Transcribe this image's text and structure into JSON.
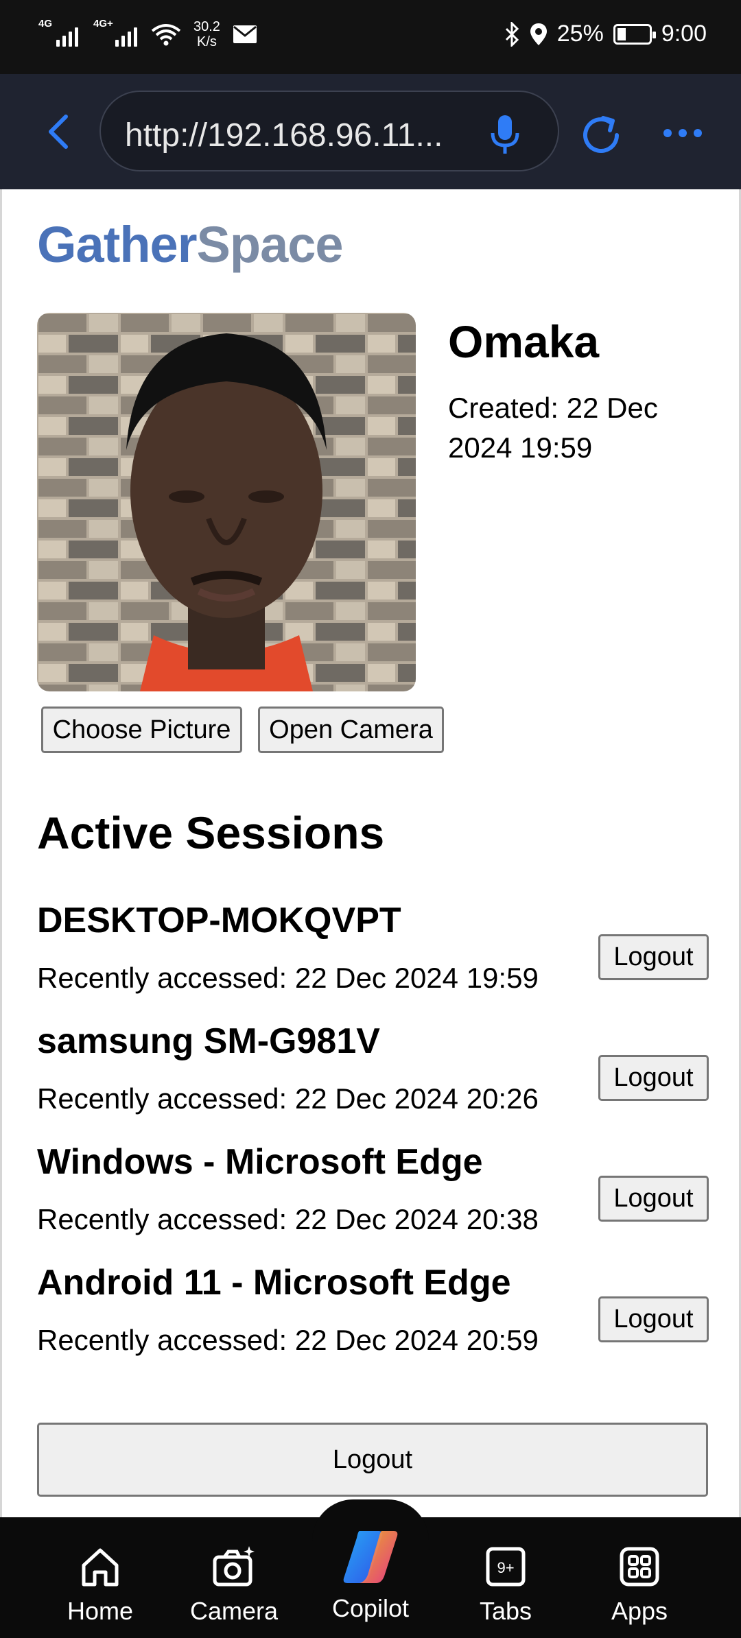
{
  "status_bar": {
    "net1": "4G",
    "net2": "4G+",
    "speed_value": "30.2",
    "speed_unit": "K/s",
    "battery": "25%",
    "time": "9:00"
  },
  "browser": {
    "url": "http://192.168.96.11..."
  },
  "page": {
    "brand_part1": "Gather",
    "brand_part2": "Space",
    "profile": {
      "name": "Omaka",
      "created": "Created: 22 Dec 2024 19:59"
    },
    "buttons": {
      "choose_picture": "Choose Picture",
      "open_camera": "Open Camera"
    },
    "sessions_title": "Active Sessions",
    "sessions": [
      {
        "device": "DESKTOP-MOKQVPT",
        "accessed": "Recently accessed: 22 Dec 2024 19:59",
        "logout": "Logout"
      },
      {
        "device": "samsung SM-G981V",
        "accessed": "Recently accessed: 22 Dec 2024 20:26",
        "logout": "Logout"
      },
      {
        "device": "Windows - Microsoft Edge",
        "accessed": "Recently accessed: 22 Dec 2024 20:38",
        "logout": "Logout"
      },
      {
        "device": "Android 11 - Microsoft Edge",
        "accessed": "Recently accessed: 22 Dec 2024 20:59",
        "logout": "Logout"
      }
    ],
    "logout_all": "Logout"
  },
  "bottom_nav": {
    "items": [
      {
        "label": "Home",
        "icon": "home-icon"
      },
      {
        "label": "Camera",
        "icon": "camera-icon"
      },
      {
        "label": "Copilot",
        "icon": "copilot-icon"
      },
      {
        "label": "Tabs",
        "icon": "tabs-icon",
        "badge": "9+"
      },
      {
        "label": "Apps",
        "icon": "apps-icon"
      }
    ]
  },
  "colors": {
    "brand_primary": "#4a72b8",
    "brand_secondary": "#7b8ba5",
    "browser_accent": "#2f7cf6",
    "browser_bar": "#1f2330"
  }
}
